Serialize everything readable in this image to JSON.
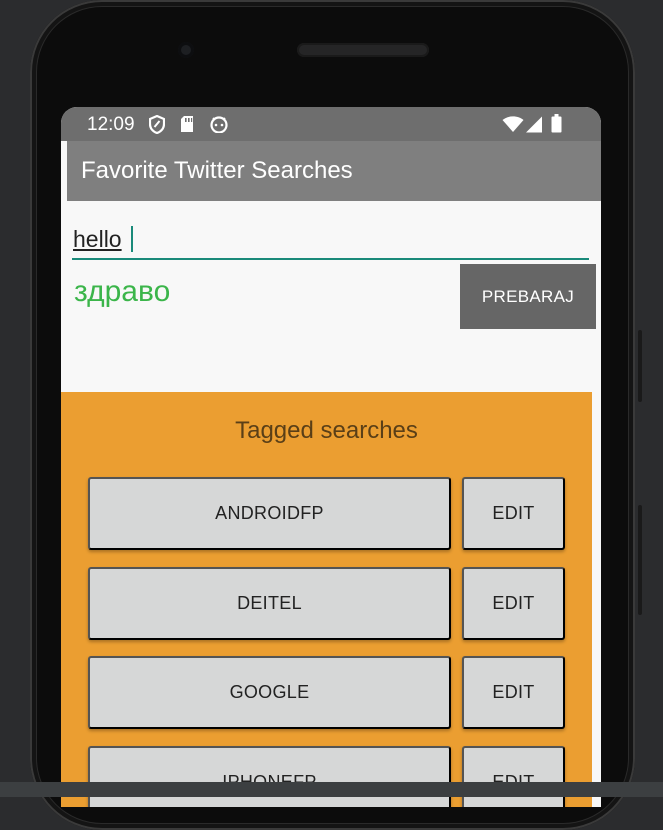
{
  "status_bar": {
    "time": "12:09",
    "icons": [
      "shield-icon",
      "sd-card-icon",
      "android-icon",
      "wifi-icon",
      "signal-icon",
      "battery-icon"
    ]
  },
  "app_bar": {
    "title": "Favorite Twitter Searches"
  },
  "query_input": {
    "value": "hello"
  },
  "tag_text": {
    "value": "здраво"
  },
  "search_button": {
    "label": "PREBARAJ"
  },
  "tagged": {
    "title": "Tagged searches",
    "items": [
      {
        "tag": "ANDROIDFP",
        "edit": "EDIT"
      },
      {
        "tag": "DEITEL",
        "edit": "EDIT"
      },
      {
        "tag": "GOOGLE",
        "edit": "EDIT"
      },
      {
        "tag": "IPHONEFP",
        "edit": "EDIT"
      }
    ]
  },
  "colors": {
    "status_bar": "#6e6e6e",
    "app_bar": "#7f7f7f",
    "accent_teal": "#1a8a7a",
    "tag_text_green": "#3bb54a",
    "tagged_panel": "#eb9e31",
    "button_gray": "#d6d7d7",
    "search_button": "#666666"
  }
}
